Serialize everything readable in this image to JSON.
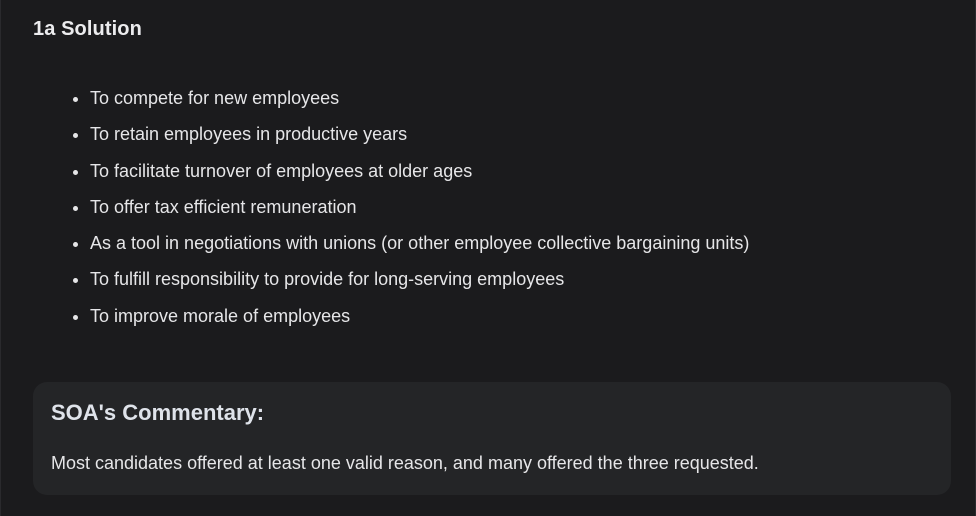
{
  "heading": "1a Solution",
  "reasons": [
    "To compete for new employees",
    "To retain employees in productive years",
    "To facilitate turnover of employees at older ages",
    "To offer tax efficient remuneration",
    "As a tool in negotiations with unions (or other employee collective bargaining units)",
    "To fulfill responsibility to provide for long-serving employees",
    "To improve morale of employees"
  ],
  "commentary": {
    "title": "SOA's Commentary:",
    "text": "Most candidates offered at least one valid reason, and many offered the three requested."
  },
  "colors": {
    "background": "#1b1b1d",
    "panel": "#242527",
    "text": "#e6e6e8"
  }
}
